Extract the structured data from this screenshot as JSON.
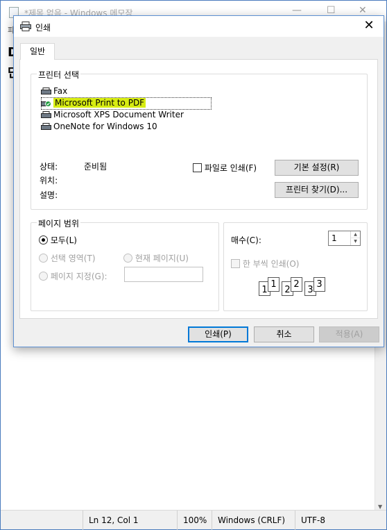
{
  "notepad": {
    "title": "*제목 없음 - Windows 메모장",
    "menu_partial": "파",
    "doc_line1": "D",
    "doc_line2": "단",
    "status": {
      "position": "Ln 12, Col 1",
      "zoom": "100%",
      "line_ending": "Windows (CRLF)",
      "encoding": "UTF-8"
    }
  },
  "dialog": {
    "title": "인쇄",
    "close_glyph": "✕",
    "tab_general": "일반",
    "printer_group": {
      "label": "프린터 선택",
      "printers": [
        {
          "name": "Fax",
          "selected": false,
          "icon": "fax-printer-icon"
        },
        {
          "name": "Microsoft Print to PDF",
          "selected": true,
          "icon": "default-printer-icon"
        },
        {
          "name": "Microsoft XPS Document Writer",
          "selected": false,
          "icon": "printer-icon"
        },
        {
          "name": "OneNote for Windows 10",
          "selected": false,
          "icon": "printer-icon"
        }
      ],
      "status_label": "상태:",
      "status_value": "준비됨",
      "location_label": "위치:",
      "comment_label": "설명:",
      "print_to_file_label": "파일로 인쇄(F)",
      "preferences_button": "기본 설정(R)",
      "find_printer_button": "프린터 찾기(D)..."
    },
    "page_range": {
      "label": "페이지 범위",
      "all": "모두(L)",
      "selection": "선택 영역(T)",
      "current_page": "현재 페이지(U)",
      "pages": "페이지 지정(G):",
      "pages_value": ""
    },
    "copies": {
      "label": "매수(C):",
      "value": "1",
      "collate_label": "한 부씩 인쇄(O)",
      "collate_pages": [
        "1",
        "1",
        "2",
        "2",
        "3",
        "3"
      ]
    },
    "buttons": {
      "print": "인쇄(P)",
      "cancel": "취소",
      "apply": "적용(A)"
    },
    "colors": {
      "selection_highlight": "#d7ec12",
      "default_button_border": "#0078d7",
      "desktop": "#1d5fa8"
    }
  }
}
